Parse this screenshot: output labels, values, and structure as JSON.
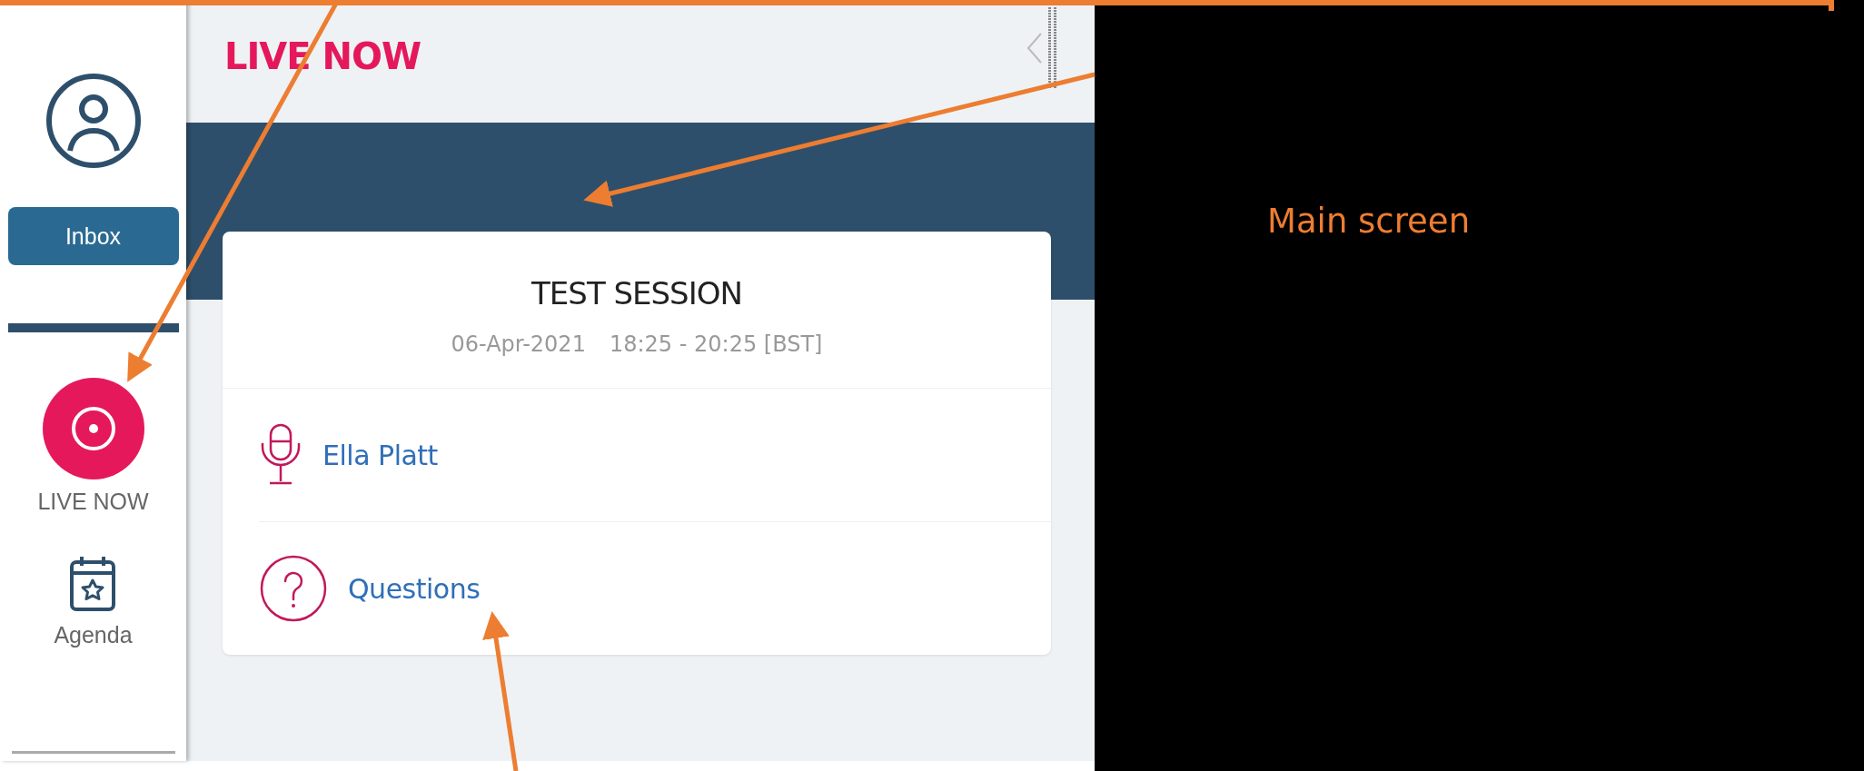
{
  "sidebar": {
    "inbox_button": "Inbox",
    "nav_items": [
      {
        "kind": "live",
        "label": "LIVE NOW",
        "selected": true
      },
      {
        "kind": "agenda",
        "label": "Agenda",
        "selected": false
      }
    ]
  },
  "panel": {
    "title": "LIVE NOW",
    "session": {
      "title": "TEST SESSION",
      "date": "06-Apr-2021",
      "time": "18:25 - 20:25 [BST]",
      "items": [
        {
          "kind": "speaker",
          "label": "Ella Platt"
        },
        {
          "kind": "questions",
          "label": "Questions"
        }
      ]
    }
  },
  "main_screen": {
    "label": "Main screen"
  }
}
